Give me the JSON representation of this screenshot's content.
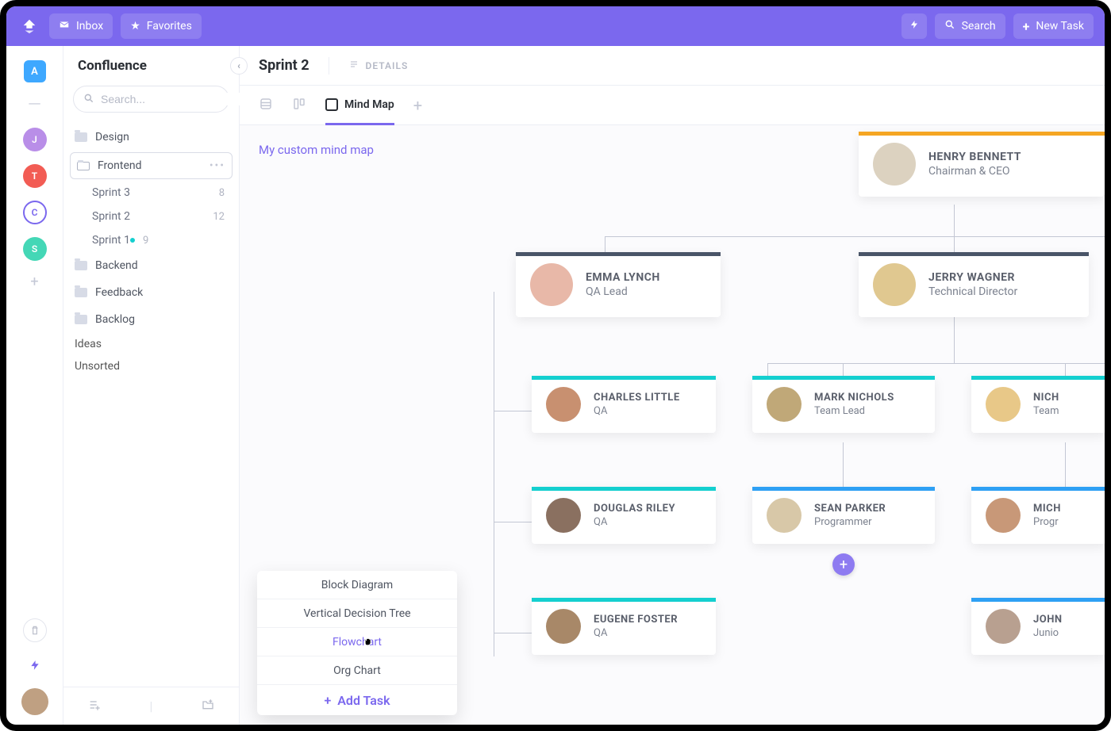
{
  "topbar": {
    "inbox": "Inbox",
    "favorites": "Favorites",
    "search": "Search",
    "new_task": "New Task"
  },
  "rail": {
    "space_letter": "A",
    "workspaces": [
      {
        "letter": "J",
        "bg": "#b98ee8"
      },
      {
        "letter": "T",
        "bg": "#f25c54"
      },
      {
        "letter": "C",
        "bg": "#ffffff",
        "fg": "#7b68ee",
        "outline": "#7b68ee"
      },
      {
        "letter": "S",
        "bg": "#44d7b6"
      }
    ]
  },
  "sidebar": {
    "title": "Confluence",
    "search_placeholder": "Search...",
    "items": [
      {
        "label": "Design",
        "type": "folder"
      },
      {
        "label": "Frontend",
        "type": "folder",
        "active": true
      },
      {
        "label": "Backend",
        "type": "folder"
      },
      {
        "label": "Feedback",
        "type": "folder"
      },
      {
        "label": "Backlog",
        "type": "folder"
      }
    ],
    "frontend_children": [
      {
        "label": "Sprint 3",
        "count": "8"
      },
      {
        "label": "Sprint 2",
        "count": "12"
      },
      {
        "label": "Sprint 1",
        "count": "9",
        "dot": true
      }
    ],
    "plain": [
      "Ideas",
      "Unsorted"
    ]
  },
  "main": {
    "title": "Sprint 2",
    "details": "DETAILS",
    "tabs": {
      "mindmap": "Mind Map"
    },
    "mindmap_title": "My custom mind map"
  },
  "org": {
    "root": {
      "name": "HENRY BENNETT",
      "role": "Chairman & CEO",
      "bar": "#f5a623",
      "av": "#dcd2c0"
    },
    "l2a": {
      "name": "EMMA LYNCH",
      "role": "QA Lead",
      "bar": "#4a5568",
      "av": "#e8b8a8"
    },
    "l2b": {
      "name": "JERRY WAGNER",
      "role": "Technical Director",
      "bar": "#4a5568",
      "av": "#e0c890"
    },
    "l3": [
      {
        "name": "CHARLES LITTLE",
        "role": "QA",
        "bar": "#14cfcf",
        "av": "#c89070"
      },
      {
        "name": "DOUGLAS RILEY",
        "role": "QA",
        "bar": "#14cfcf",
        "av": "#8a7060"
      },
      {
        "name": "EUGENE FOSTER",
        "role": "QA",
        "bar": "#14cfcf",
        "av": "#a88868"
      },
      {
        "name": "MARK NICHOLS",
        "role": "Team Lead",
        "bar": "#14cfcf",
        "av": "#c0a878"
      },
      {
        "name": "SEAN PARKER",
        "role": "Programmer",
        "bar": "#2ea0f4",
        "av": "#d8c8a8"
      },
      {
        "name": "NICH",
        "role": "Team",
        "bar": "#14cfcf",
        "av": "#e8c888"
      },
      {
        "name": "MICH",
        "role": "Progr",
        "bar": "#2ea0f4",
        "av": "#c89878"
      },
      {
        "name": "JOHN",
        "role": "Junio",
        "bar": "#2ea0f4",
        "av": "#b8a090"
      }
    ]
  },
  "popup": {
    "items": [
      "Block Diagram",
      "Vertical Decision Tree",
      "Flowchart",
      "Org Chart"
    ],
    "add": "Add Task"
  },
  "colors": {
    "accent": "#7b68ee"
  }
}
